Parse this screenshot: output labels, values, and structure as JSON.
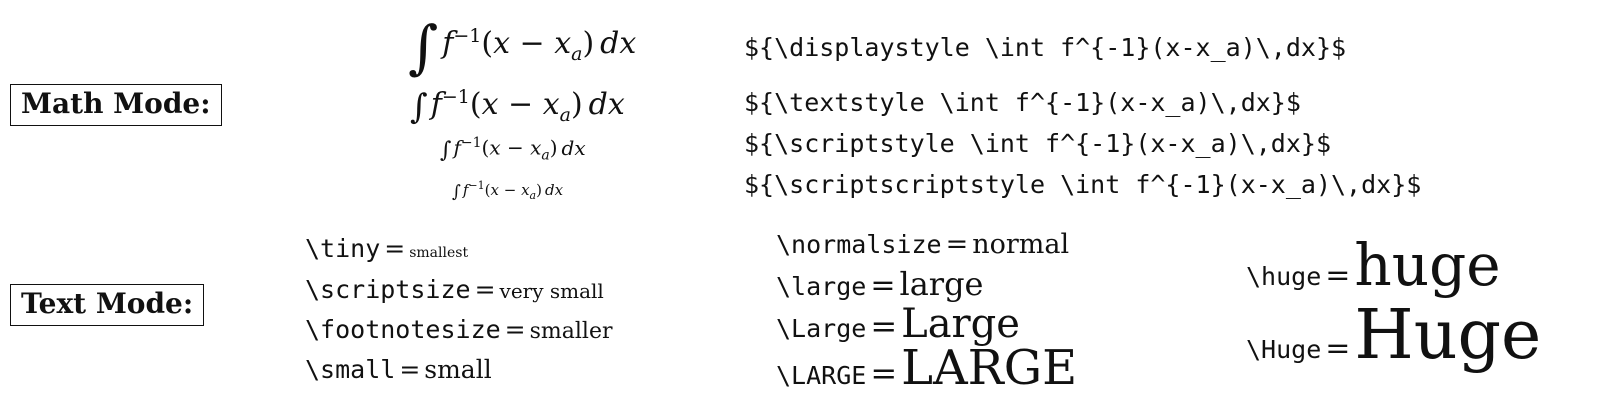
{
  "math_mode": {
    "label": "Math Mode:",
    "rows": [
      {
        "name": "displaystyle",
        "code": "${\\displaystyle \\int f^{-1}(x-x_a)\\,dx}$"
      },
      {
        "name": "textstyle",
        "code": "${\\textstyle \\int f^{-1}(x-x_a)\\,dx}$"
      },
      {
        "name": "scriptstyle",
        "code": "${\\scriptstyle \\int f^{-1}(x-x_a)\\,dx}$"
      },
      {
        "name": "scriptscriptstyle",
        "code": "${\\scriptscriptstyle \\int f^{-1}(x-x_a)\\,dx}$"
      }
    ],
    "formula": {
      "integral": "∫",
      "func": "f",
      "sup": "−1",
      "open": "(",
      "x": "x",
      "minus": " − ",
      "xa": "x",
      "sub": "a",
      "close": ")",
      "d": "dx"
    }
  },
  "text_mode": {
    "label": "Text Mode:",
    "equals": "=",
    "sizes": [
      {
        "cmd": "\\tiny",
        "sample": "smallest"
      },
      {
        "cmd": "\\scriptsize",
        "sample": "very small"
      },
      {
        "cmd": "\\footnotesize",
        "sample": "smaller"
      },
      {
        "cmd": "\\small",
        "sample": "small"
      },
      {
        "cmd": "\\normalsize",
        "sample": "normal"
      },
      {
        "cmd": "\\large",
        "sample": "large"
      },
      {
        "cmd": "\\Large",
        "sample": "Large"
      },
      {
        "cmd": "\\LARGE",
        "sample": "LARGE"
      },
      {
        "cmd": "\\huge",
        "sample": "huge"
      },
      {
        "cmd": "\\Huge",
        "sample": "Huge"
      }
    ]
  }
}
